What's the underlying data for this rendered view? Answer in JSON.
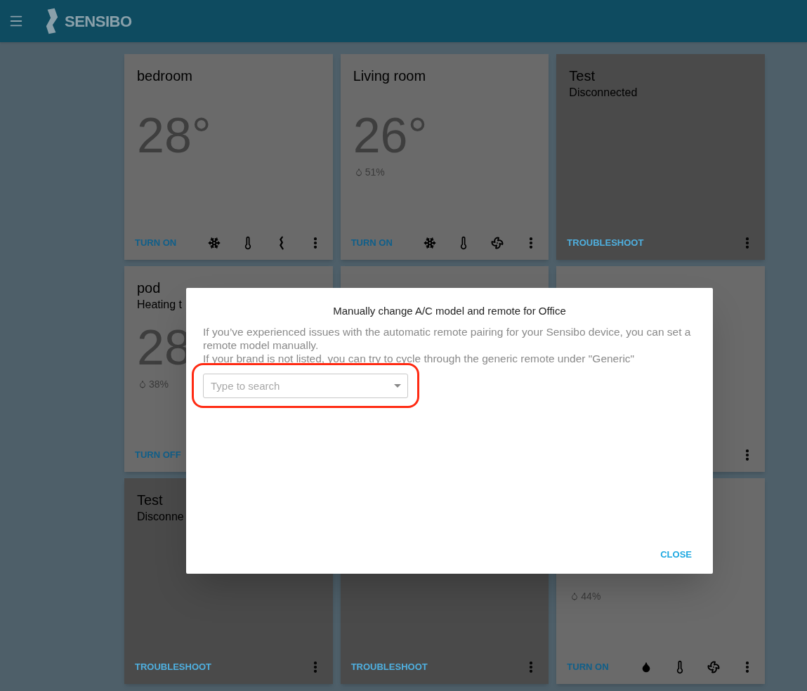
{
  "header": {
    "brand": "SENSIBO"
  },
  "cards": [
    {
      "kind": "device",
      "name": "bedroom",
      "temperature": "28°",
      "action": "TURN ON",
      "icons": [
        {
          "kind": "snowflake"
        },
        {
          "kind": "thermometer"
        },
        {
          "kind": "squiggle"
        },
        {
          "kind": "more"
        }
      ]
    },
    {
      "kind": "device",
      "name": "Living room",
      "temperature": "26°",
      "humidity": "51%",
      "action": "TURN ON",
      "icons": [
        {
          "kind": "snowflake"
        },
        {
          "kind": "thermometer"
        },
        {
          "kind": "fan"
        },
        {
          "kind": "more"
        }
      ]
    },
    {
      "kind": "disconnected",
      "name": "Test",
      "status": "Disconnected",
      "action": "TROUBLESHOOT",
      "icons": [
        {
          "kind": "more"
        }
      ]
    },
    {
      "kind": "device",
      "name": "pod",
      "status": "Heating t",
      "temperature": "28",
      "humidity": "38%",
      "action": "TURN OFF"
    },
    {
      "kind": "device"
    },
    {
      "kind": "device",
      "icons": [
        {
          "kind": "more"
        }
      ]
    },
    {
      "kind": "disconnected",
      "name": "Test",
      "status": "Disconne",
      "action": "TROUBLESHOOT",
      "icons": [
        {
          "kind": "more"
        }
      ]
    },
    {
      "kind": "disconnected",
      "action": "TROUBLESHOOT",
      "icons": [
        {
          "kind": "more"
        }
      ]
    },
    {
      "kind": "device",
      "humidity": "44%",
      "action": "TURN ON",
      "icons": [
        {
          "kind": "drop"
        },
        {
          "kind": "thermometer"
        },
        {
          "kind": "fan"
        },
        {
          "kind": "more"
        }
      ]
    }
  ],
  "dialog": {
    "title": "Manually change A/C model and remote for Office",
    "description": [
      "If you’ve experienced issues with the automatic remote pairing for your Sensibo device, you can set a remote model manually.",
      "If your brand is not listed, you can try to cycle through the generic remote under \"Generic\""
    ],
    "search": {
      "placeholder": "Type to search",
      "highlighted": true
    },
    "close": "CLOSE"
  }
}
